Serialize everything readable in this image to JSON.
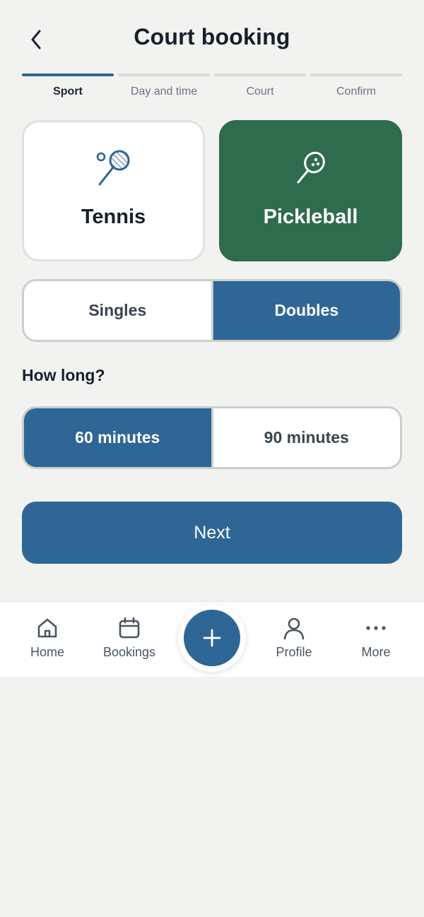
{
  "header": {
    "title": "Court booking",
    "back_icon": "chevron-left-icon"
  },
  "steps": [
    {
      "label": "Sport",
      "active": true
    },
    {
      "label": "Day and time",
      "active": false
    },
    {
      "label": "Court",
      "active": false
    },
    {
      "label": "Confirm",
      "active": false
    }
  ],
  "sports": [
    {
      "name": "Tennis",
      "icon": "tennis-racket-icon",
      "selected": false
    },
    {
      "name": "Pickleball",
      "icon": "pickleball-paddle-icon",
      "selected": true
    }
  ],
  "format": {
    "options": [
      "Singles",
      "Doubles"
    ],
    "selected": "Doubles"
  },
  "duration": {
    "label": "How long?",
    "options": [
      "60 minutes",
      "90 minutes"
    ],
    "selected": "60 minutes"
  },
  "next_button": {
    "label": "Next"
  },
  "bottom_nav": {
    "items": [
      {
        "label": "Home",
        "icon": "home-icon"
      },
      {
        "label": "Bookings",
        "icon": "calendar-icon"
      },
      {
        "label": "Profile",
        "icon": "user-icon"
      },
      {
        "label": "More",
        "icon": "more-dots-icon"
      }
    ],
    "fab_icon": "plus-icon"
  },
  "colors": {
    "primary_blue": "#2e6696",
    "selected_green": "#2f6b4d",
    "background": "#f2f3f1"
  }
}
